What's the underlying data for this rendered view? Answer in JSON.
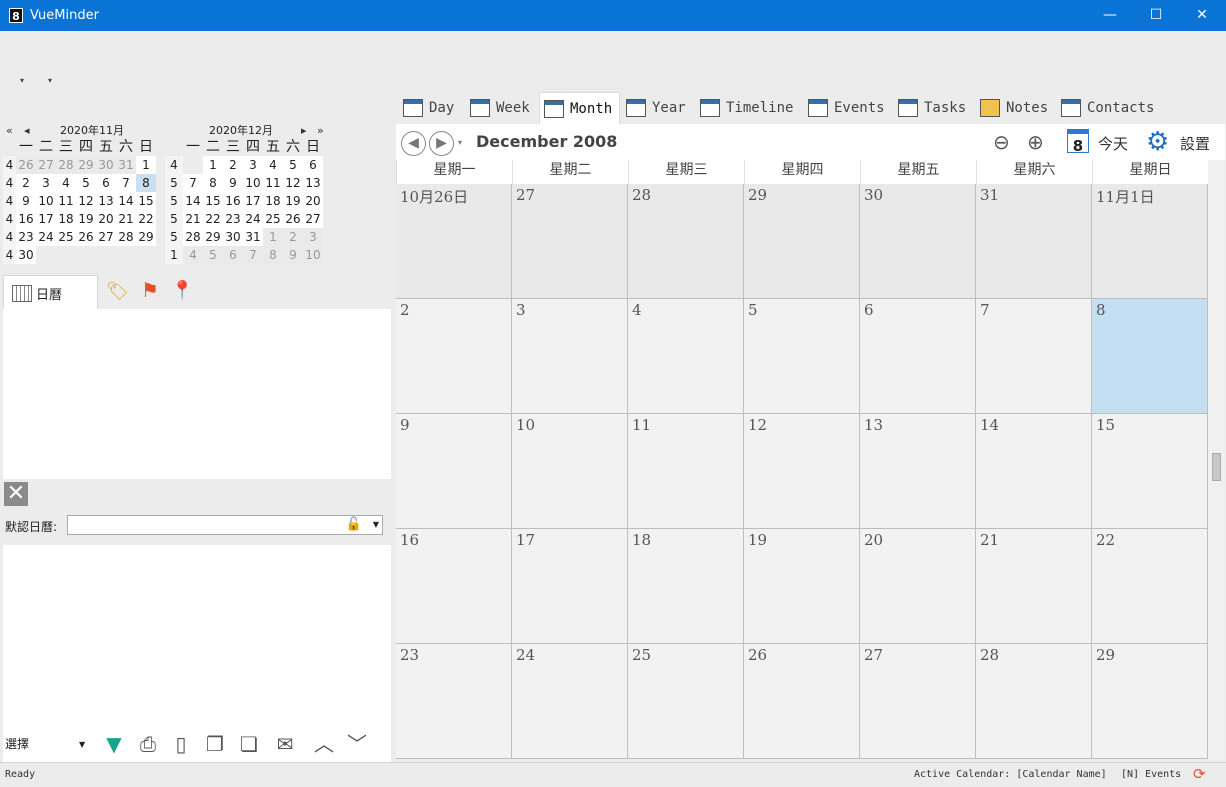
{
  "window": {
    "title": "VueMinder",
    "icon_text": "8",
    "minimize": "—",
    "maximize": "☐",
    "close": "✕"
  },
  "mini_calendars": {
    "nav_prev_year": "«",
    "nav_prev": "◂",
    "nav_next": "▸",
    "nav_next_year": "»",
    "dow": [
      "一",
      "二",
      "三",
      "四",
      "五",
      "六",
      "日"
    ],
    "november": {
      "title": "2020年11月",
      "weeks": [
        {
          "wk": "4",
          "days": [
            [
              "26",
              "other"
            ],
            [
              "27",
              "other"
            ],
            [
              "28",
              "other"
            ],
            [
              "29",
              "other"
            ],
            [
              "30",
              "other"
            ],
            [
              "31",
              "other"
            ],
            [
              "1",
              "cur"
            ]
          ]
        },
        {
          "wk": "4",
          "days": [
            [
              "2",
              "cur"
            ],
            [
              "3",
              "cur"
            ],
            [
              "4",
              "cur"
            ],
            [
              "5",
              "cur"
            ],
            [
              "6",
              "cur"
            ],
            [
              "7",
              "cur"
            ],
            [
              "8",
              "today"
            ]
          ]
        },
        {
          "wk": "4",
          "days": [
            [
              "9",
              "cur"
            ],
            [
              "10",
              "cur"
            ],
            [
              "11",
              "cur"
            ],
            [
              "12",
              "cur"
            ],
            [
              "13",
              "cur"
            ],
            [
              "14",
              "cur"
            ],
            [
              "15",
              "cur"
            ]
          ]
        },
        {
          "wk": "4",
          "days": [
            [
              "16",
              "cur"
            ],
            [
              "17",
              "cur"
            ],
            [
              "18",
              "cur"
            ],
            [
              "19",
              "cur"
            ],
            [
              "20",
              "cur"
            ],
            [
              "21",
              "cur"
            ],
            [
              "22",
              "cur"
            ]
          ]
        },
        {
          "wk": "4",
          "days": [
            [
              "23",
              "cur"
            ],
            [
              "24",
              "cur"
            ],
            [
              "25",
              "cur"
            ],
            [
              "26",
              "cur"
            ],
            [
              "27",
              "cur"
            ],
            [
              "28",
              "cur"
            ],
            [
              "29",
              "cur"
            ]
          ]
        },
        {
          "wk": "4",
          "days": [
            [
              "30",
              "cur"
            ],
            [
              "",
              ""
            ],
            [
              "",
              ""
            ],
            [
              "",
              ""
            ],
            [
              "",
              ""
            ],
            [
              "",
              ""
            ],
            [
              "",
              ""
            ]
          ]
        }
      ]
    },
    "december": {
      "title": "2020年12月",
      "weeks": [
        {
          "wk": "4",
          "days": [
            [
              "",
              ""
            ],
            [
              "1",
              "cur"
            ],
            [
              "2",
              "cur"
            ],
            [
              "3",
              "cur"
            ],
            [
              "4",
              "cur"
            ],
            [
              "5",
              "cur"
            ],
            [
              "6",
              "cur"
            ]
          ]
        },
        {
          "wk": "5",
          "days": [
            [
              "7",
              "cur"
            ],
            [
              "8",
              "cur"
            ],
            [
              "9",
              "cur"
            ],
            [
              "10",
              "cur"
            ],
            [
              "11",
              "cur"
            ],
            [
              "12",
              "cur"
            ],
            [
              "13",
              "cur"
            ]
          ]
        },
        {
          "wk": "5",
          "days": [
            [
              "14",
              "cur"
            ],
            [
              "15",
              "cur"
            ],
            [
              "16",
              "cur"
            ],
            [
              "17",
              "cur"
            ],
            [
              "18",
              "cur"
            ],
            [
              "19",
              "cur"
            ],
            [
              "20",
              "cur"
            ]
          ]
        },
        {
          "wk": "5",
          "days": [
            [
              "21",
              "cur"
            ],
            [
              "22",
              "cur"
            ],
            [
              "23",
              "cur"
            ],
            [
              "24",
              "cur"
            ],
            [
              "25",
              "cur"
            ],
            [
              "26",
              "cur"
            ],
            [
              "27",
              "cur"
            ]
          ]
        },
        {
          "wk": "5",
          "days": [
            [
              "28",
              "cur"
            ],
            [
              "29",
              "cur"
            ],
            [
              "30",
              "cur"
            ],
            [
              "31",
              "cur"
            ],
            [
              "1",
              "other"
            ],
            [
              "2",
              "other"
            ],
            [
              "3",
              "other"
            ]
          ]
        },
        {
          "wk": "1",
          "days": [
            [
              "4",
              "other"
            ],
            [
              "5",
              "other"
            ],
            [
              "6",
              "other"
            ],
            [
              "7",
              "other"
            ],
            [
              "8",
              "other"
            ],
            [
              "9",
              "other"
            ],
            [
              "10",
              "other"
            ]
          ]
        }
      ]
    }
  },
  "left_tabs": {
    "calendar_label": "日曆",
    "tag_icon": "🏷",
    "flag_icon": "⚑",
    "location_icon": "📍"
  },
  "default_calendar": {
    "label": "默認日曆:",
    "value": ""
  },
  "bottom_toolbar": {
    "select_label": "選擇"
  },
  "main_tabs": [
    {
      "label": "Day"
    },
    {
      "label": "Week"
    },
    {
      "label": "Month"
    },
    {
      "label": "Year"
    },
    {
      "label": "Timeline"
    },
    {
      "label": "Events"
    },
    {
      "label": "Tasks"
    },
    {
      "label": "Notes"
    },
    {
      "label": "Contacts"
    }
  ],
  "nav": {
    "title": "December 2008",
    "today_icon_num": "8",
    "today_label": "今天",
    "settings_label": "設置"
  },
  "weekdays": [
    "星期一",
    "星期二",
    "星期三",
    "星期四",
    "星期五",
    "星期六",
    "星期日"
  ],
  "month_cells": [
    [
      "10月26日",
      "past"
    ],
    [
      "27",
      "past"
    ],
    [
      "28",
      "past"
    ],
    [
      "29",
      "past"
    ],
    [
      "30",
      "past"
    ],
    [
      "31",
      "past"
    ],
    [
      "11月1日",
      "past"
    ],
    [
      "2",
      ""
    ],
    [
      "3",
      ""
    ],
    [
      "4",
      ""
    ],
    [
      "5",
      ""
    ],
    [
      "6",
      ""
    ],
    [
      "7",
      ""
    ],
    [
      "8",
      "today"
    ],
    [
      "9",
      ""
    ],
    [
      "10",
      ""
    ],
    [
      "11",
      ""
    ],
    [
      "12",
      ""
    ],
    [
      "13",
      ""
    ],
    [
      "14",
      ""
    ],
    [
      "15",
      ""
    ],
    [
      "16",
      ""
    ],
    [
      "17",
      ""
    ],
    [
      "18",
      ""
    ],
    [
      "19",
      ""
    ],
    [
      "20",
      ""
    ],
    [
      "21",
      ""
    ],
    [
      "22",
      ""
    ],
    [
      "23",
      ""
    ],
    [
      "24",
      ""
    ],
    [
      "25",
      ""
    ],
    [
      "26",
      ""
    ],
    [
      "27",
      ""
    ],
    [
      "28",
      ""
    ],
    [
      "29",
      ""
    ]
  ],
  "status": {
    "left": "Ready",
    "active_calendar": "Active Calendar: [Calendar Name]",
    "events": "[N] Events"
  }
}
